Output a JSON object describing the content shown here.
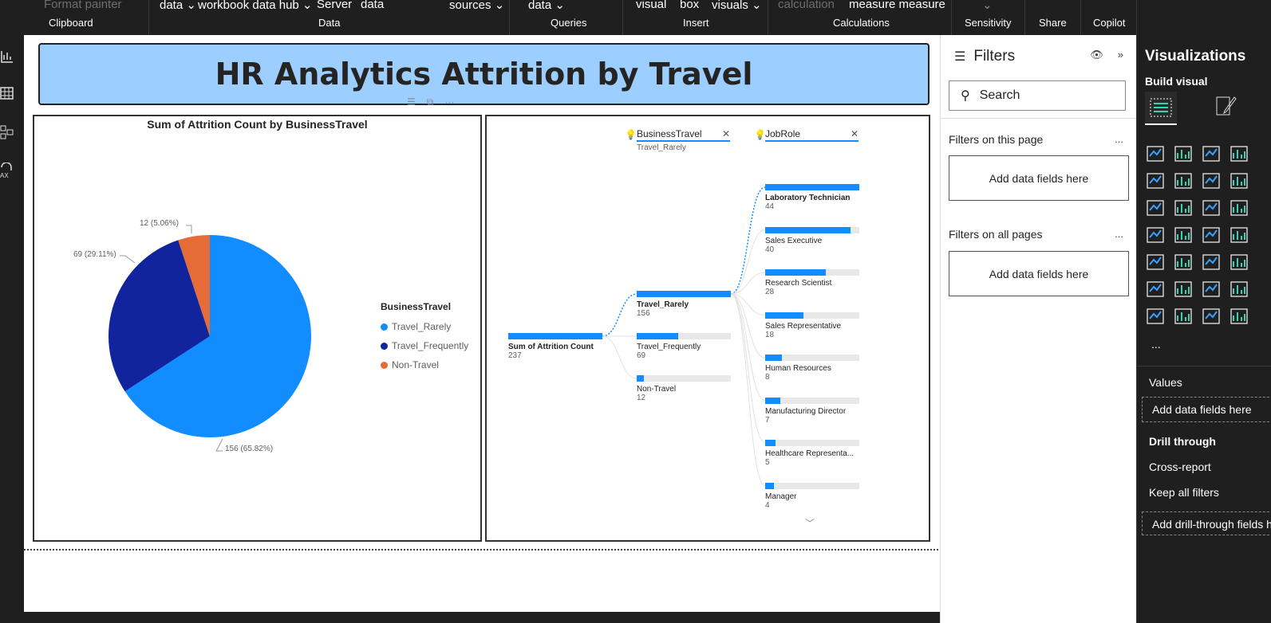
{
  "ribbon": {
    "items": [
      "Format painter",
      "data",
      "workbook data hub",
      "Server",
      "data",
      "sources",
      "data",
      "visual",
      "box",
      "visuals",
      "calculation",
      "measure measure",
      "⌄"
    ],
    "groups": [
      "Clipboard",
      "Data",
      "Queries",
      "Insert",
      "Calculations",
      "Sensitivity",
      "Share",
      "Copilot"
    ]
  },
  "report": {
    "title": "HR Analytics Attrition by Travel"
  },
  "pie": {
    "title": "Sum of Attrition Count by BusinessTravel",
    "labels": [
      "12 (5.06%)",
      "69 (29.11%)",
      "156 (65.82%)"
    ],
    "legend_title": "BusinessTravel",
    "legend": [
      "Travel_Rarely",
      "Travel_Frequently",
      "Non-Travel"
    ]
  },
  "chart_data": {
    "type": "pie",
    "title": "Sum of Attrition Count by BusinessTravel",
    "categories": [
      "Travel_Rarely",
      "Travel_Frequently",
      "Non-Travel"
    ],
    "values": [
      156,
      69,
      12
    ],
    "percent": [
      65.82,
      29.11,
      5.06
    ],
    "colors": [
      "#118dff",
      "#12239e",
      "#e66c37"
    ],
    "legend_placement": "right"
  },
  "tree": {
    "level1": {
      "name": "BusinessTravel",
      "selected": "Travel_Rarely"
    },
    "level2": {
      "name": "JobRole"
    },
    "root": {
      "label": "Sum of Attrition Count",
      "value": "237",
      "fraction": 1.0
    },
    "travel": [
      {
        "label": "Travel_Rarely",
        "value": "156",
        "fraction": 1.0
      },
      {
        "label": "Travel_Frequently",
        "value": "69",
        "fraction": 0.44
      },
      {
        "label": "Non-Travel",
        "value": "12",
        "fraction": 0.077
      }
    ],
    "roles": [
      {
        "label": "Laboratory Technician",
        "value": "44",
        "fraction": 1.0
      },
      {
        "label": "Sales Executive",
        "value": "40",
        "fraction": 0.91
      },
      {
        "label": "Research Scientist",
        "value": "28",
        "fraction": 0.64
      },
      {
        "label": "Sales Representative",
        "value": "18",
        "fraction": 0.41
      },
      {
        "label": "Human Resources",
        "value": "8",
        "fraction": 0.18
      },
      {
        "label": "Manufacturing Director",
        "value": "7",
        "fraction": 0.16
      },
      {
        "label": "Healthcare Representa...",
        "value": "5",
        "fraction": 0.11
      },
      {
        "label": "Manager",
        "value": "4",
        "fraction": 0.09
      }
    ]
  },
  "filters": {
    "title": "Filters",
    "search_placeholder": "Search",
    "this_page": "Filters on this page",
    "all_pages": "Filters on all pages",
    "add_fields": "Add data fields here",
    "more": "..."
  },
  "viz": {
    "title": "Visualizations",
    "build": "Build visual",
    "more": "...",
    "values": "Values",
    "add_fields": "Add data fields here",
    "drill": "Drill through",
    "cross": "Cross-report",
    "keep": "Keep all filters",
    "add_drill": "Add drill-through fields here"
  }
}
